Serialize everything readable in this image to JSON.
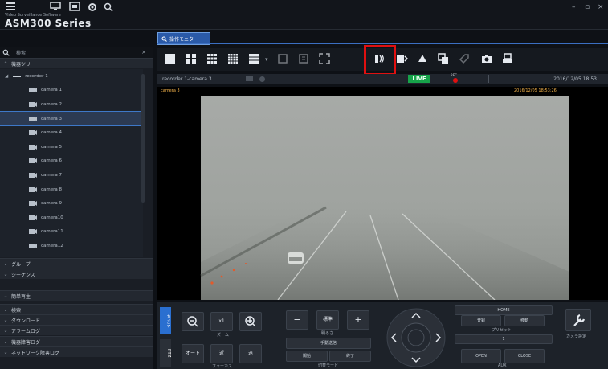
{
  "app": {
    "subtitle": "Video Surveillance Software",
    "title": "ASM300 Series"
  },
  "window_controls": [
    "–",
    "▫",
    "×"
  ],
  "sidebar": {
    "search_label": "検索",
    "device_tree_label": "機器ツリー",
    "recorder": "recorder 1",
    "cameras": [
      "camera 1",
      "camera 2",
      "camera 3",
      "camera 4",
      "camera 5",
      "camera 6",
      "camera 7",
      "camera 8",
      "camera 9",
      "camera10",
      "camera11",
      "camera12"
    ],
    "selected_camera": "camera 3",
    "sections": [
      "グループ",
      "シーケンス",
      "簡単再生",
      "検索",
      "ダウンロード",
      "アラームログ",
      "機器障害ログ",
      "ネットワーク障害ログ"
    ]
  },
  "tab": {
    "label": "操作モニター"
  },
  "infobar": {
    "camera_name": "recorder 1-camera 3",
    "live": "LIVE",
    "rec": "REC",
    "datetime": "2016/12/05 18:53"
  },
  "video": {
    "overlay_left": "camera 3",
    "overlay_right": "2016/12/05 18:53:26"
  },
  "controls": {
    "tab_camera": "カメラ",
    "tab_ptz": "PTZ",
    "zoom_x1": "x1",
    "zoom_caption": "ズーム",
    "auto": "オート",
    "near": "近",
    "far": "遠",
    "focus_caption": "フォーカス",
    "minus": "−",
    "standard": "標準",
    "plus": "+",
    "brightness_caption": "明るさ",
    "aux_select": "手動送信",
    "open": "開始",
    "end": "終了",
    "image_mode_caption": "切替モード",
    "home": "HOME",
    "register": "登録",
    "move": "移動",
    "preset_caption": "プリセット",
    "preset_no": "1",
    "open_en": "OPEN",
    "close_en": "CLOSE",
    "aux_caption": "AUX",
    "camera_settings": "カメラ設定"
  },
  "colors": {
    "accent": "#2a6fd0",
    "live": "#17a34a",
    "highlight": "#e01010",
    "rec": "#e01010"
  }
}
